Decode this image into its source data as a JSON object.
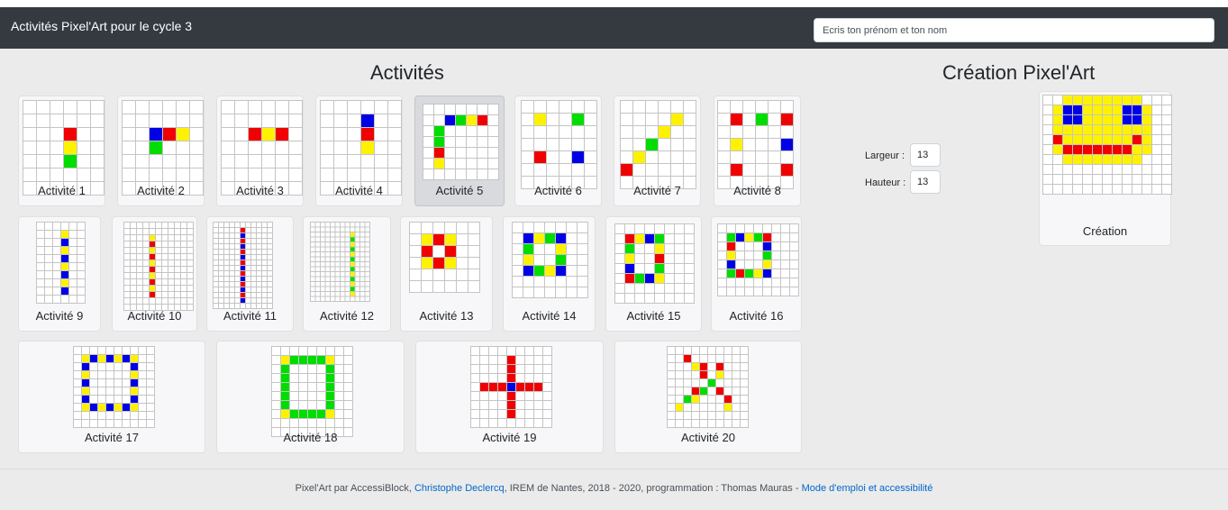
{
  "header": {
    "title": "Activités Pixel'Art pour le cycle 3",
    "name_placeholder": "Ecris ton prénom et ton nom"
  },
  "activities_heading": "Activités",
  "creation_heading": "Création Pixel'Art",
  "colors": {
    "R": "#f00000",
    "Y": "#fff200",
    "G": "#00dd00",
    "B": "#0000e6",
    "grid": "#c4c4c4",
    "cell": "#ffffff"
  },
  "activities": [
    {
      "label": "Activité 1",
      "grid": [
        "......",
        "......",
        "...R..",
        "...Y..",
        "...G..",
        "......",
        "......"
      ]
    },
    {
      "label": "Activité 2",
      "grid": [
        "......",
        "......",
        "..BRY.",
        "..G...",
        "......",
        "......",
        "......"
      ]
    },
    {
      "label": "Activité 3",
      "grid": [
        "......",
        "......",
        "..RYR.",
        "......",
        "......",
        "......",
        "......"
      ]
    },
    {
      "label": "Activité 4",
      "grid": [
        "......",
        "...B..",
        "...R..",
        "...Y..",
        "......",
        "......",
        "......"
      ]
    },
    {
      "label": "Activité 5",
      "grid": [
        ".......",
        "..BGYR.",
        ".G.....",
        ".G.....",
        ".R.....",
        ".Y.....",
        "......."
      ]
    },
    {
      "label": "Activité 6",
      "grid": [
        "......",
        ".Y..G.",
        "......",
        "......",
        ".R..B.",
        "......",
        "......"
      ]
    },
    {
      "label": "Activité 7",
      "grid": [
        "......",
        "....Y.",
        "...Y..",
        "..G...",
        ".Y....",
        "R.....",
        "......"
      ]
    },
    {
      "label": "Activité 8",
      "grid": [
        "......",
        ".R.G.R",
        "......",
        ".Y...B",
        "......",
        ".R...R",
        "......"
      ]
    },
    {
      "label": "Activité 9",
      "grid": [
        "......",
        "...Y..",
        "...B..",
        "...Y..",
        "...B..",
        "...Y..",
        "...B..",
        "...Y..",
        "...B..",
        "......"
      ]
    },
    {
      "label": "Activité 10",
      "grid": [
        "..........",
        "..........",
        "....Y.....",
        "....R.....",
        "....Y.....",
        "....R.....",
        "....Y.....",
        "....R.....",
        "....Y.....",
        "....R.....",
        "....Y.....",
        "....R.....",
        "...........",
        ".........."
      ]
    },
    {
      "label": "Activité 11",
      "grid": [
        "...........",
        ".....R.....",
        ".....B.....",
        ".....R.....",
        ".....B.....",
        ".....R.....",
        ".....B.....",
        ".....R.....",
        ".....B.....",
        ".....R.....",
        ".....B.....",
        ".....R.....",
        ".....B.....",
        ".....R.....",
        ".....B.....",
        "..........."
      ]
    },
    {
      "label": "Activité 12",
      "grid": [
        "............",
        "............",
        "........Y...",
        "........G...",
        "........Y...",
        "........G...",
        "........Y...",
        "........G...",
        "........Y...",
        "........G...",
        "........Y...",
        "........G...",
        "........Y...",
        "........G...",
        "........Y...",
        "............"
      ]
    },
    {
      "label": "Activité 13",
      "grid": [
        "......",
        ".YRY..",
        ".R.R..",
        ".YRY..",
        "......",
        "......"
      ]
    },
    {
      "label": "Activité 14",
      "grid": [
        ".......",
        ".BYGB..",
        ".G..Y..",
        ".Y..G..",
        ".BGYB..",
        ".......",
        "......."
      ]
    },
    {
      "label": "Activité 15",
      "grid": [
        "........",
        ".RYBG...",
        ".G..Y...",
        ".Y..R...",
        ".B..G...",
        ".RGBY...",
        "........",
        "........"
      ]
    },
    {
      "label": "Activité 16",
      "grid": [
        ".........",
        ".GBYGR...",
        ".R...B...",
        ".Y...G...",
        ".B...Y...",
        ".GRGYB...",
        ".........",
        "........."
      ]
    },
    {
      "label": "Activité 17",
      "grid": [
        "..........",
        ".YBYBYBY..",
        ".B.....B..",
        ".Y.....Y..",
        ".B.....B..",
        ".Y.....Y..",
        ".B.....B..",
        ".YBYBYBY..",
        "..........",
        ".........."
      ]
    },
    {
      "label": "Activité 18",
      "grid": [
        ".........",
        ".YGGGGY..",
        ".G....G..",
        ".G....G..",
        ".G....G..",
        ".G....G..",
        ".G....G..",
        ".YGGGGY..",
        ".........",
        "........."
      ]
    },
    {
      "label": "Activité 19",
      "grid": [
        ".........",
        "....R....",
        "....R....",
        "....R....",
        ".RRRBRRR.",
        "....R....",
        "....R....",
        "....R....",
        "........."
      ]
    },
    {
      "label": "Activité 20",
      "grid": [
        "..........",
        "..R.......",
        "...YR.R...",
        "....R.Y...",
        ".....G....",
        "...RG.R...",
        "..GY...R..",
        ".Y.....Y..",
        "..........",
        ".........."
      ]
    }
  ],
  "dimensions": {
    "width_label": "Largeur :",
    "width_value": "13",
    "height_label": "Hauteur :",
    "height_value": "13"
  },
  "creation": {
    "label": "Création",
    "grid": [
      "..YYYYYYYY...",
      ".YBBYYYYBBY..",
      ".YBBYYYYBBY..",
      ".YYYYYYYYYY..",
      ".RYYYYYYYRY..",
      ".YRRRRRRRYY..",
      "..YYYYYYYY...",
      ".............",
      ".............",
      "............."
    ]
  },
  "footer": {
    "text_before": "Pixel'Art par AccessiBlock, ",
    "link_author": "Christophe Declercq",
    "text_middle": ", IREM de Nantes, 2018 - 2020, programmation : Thomas Mauras - ",
    "link_help": "Mode d'emploi et accessibilité"
  }
}
